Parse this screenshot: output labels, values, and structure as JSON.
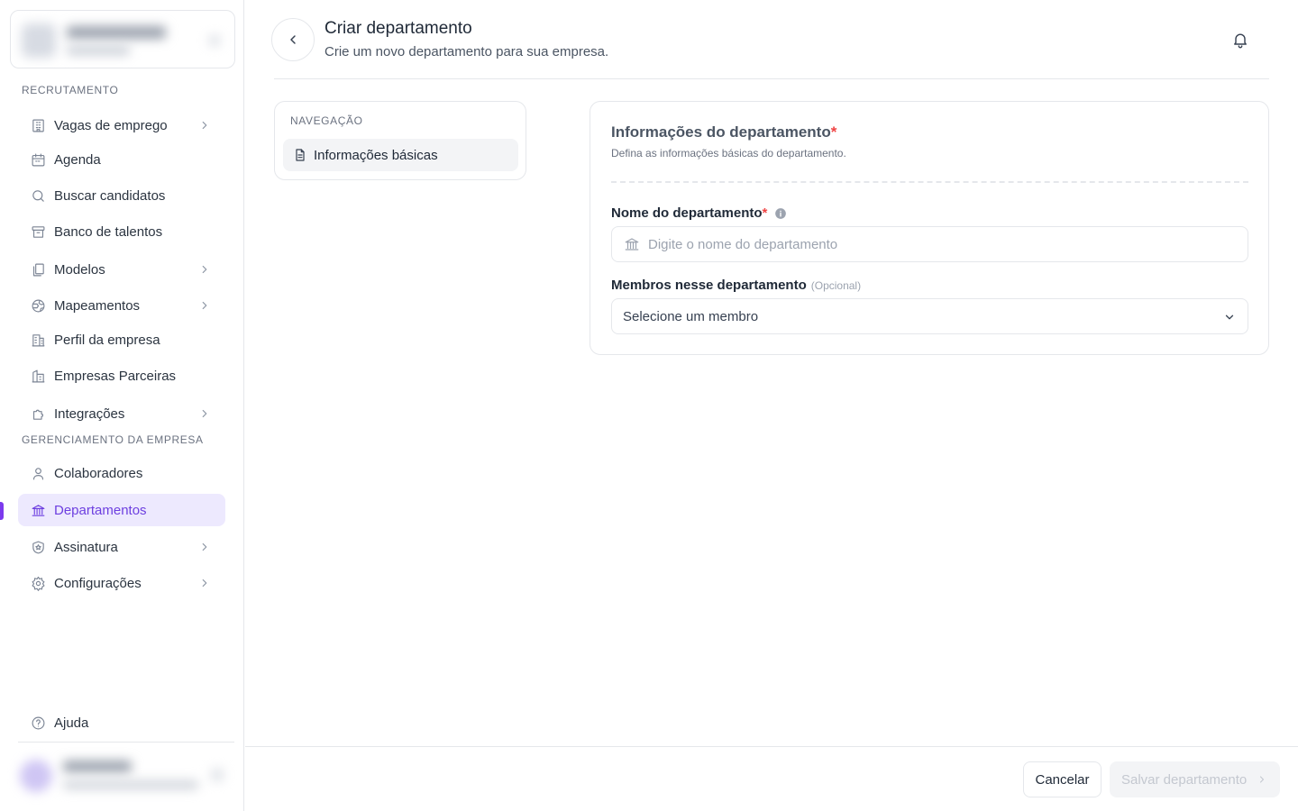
{
  "sidebar": {
    "sections": [
      {
        "label": "RECRUTAMENTO"
      },
      {
        "label": "GERENCIAMENTO DA EMPRESA"
      }
    ],
    "items": [
      {
        "label": "Vagas de emprego",
        "icon": "building-icon"
      },
      {
        "label": "Agenda",
        "icon": "calendar-icon"
      },
      {
        "label": "Buscar candidatos",
        "icon": "search-icon"
      },
      {
        "label": "Banco de talentos",
        "icon": "archive-icon"
      },
      {
        "label": "Modelos",
        "icon": "copy-icon"
      },
      {
        "label": "Mapeamentos",
        "icon": "globe-icon"
      },
      {
        "label": "Perfil da empresa",
        "icon": "company-icon"
      },
      {
        "label": "Empresas Parceiras",
        "icon": "partners-icon"
      },
      {
        "label": "Integrações",
        "icon": "puzzle-icon"
      },
      {
        "label": "Colaboradores",
        "icon": "user-icon"
      },
      {
        "label": "Departamentos",
        "icon": "bank-icon",
        "active": true
      },
      {
        "label": "Assinatura",
        "icon": "shield-icon"
      },
      {
        "label": "Configurações",
        "icon": "gear-icon"
      }
    ],
    "help_label": "Ajuda"
  },
  "header": {
    "title": "Criar departamento",
    "subtitle": "Crie um novo departamento para sua empresa."
  },
  "nav_card": {
    "label": "NAVEGAÇÃO",
    "item": "Informações básicas"
  },
  "form": {
    "title": "Informações do departamento",
    "required_mark": "*",
    "description": "Defina as informações básicas do departamento.",
    "name_label": "Nome do departamento",
    "name_placeholder": "Digite o nome do departamento",
    "members_label": "Membros nesse departamento",
    "members_optional": "(Opcional)",
    "members_value": "Selecione um membro"
  },
  "footer": {
    "cancel_label": "Cancelar",
    "save_label": "Salvar departamento"
  },
  "colors": {
    "accent": "#7c3aed",
    "active_bg": "#ede9fe",
    "required": "#ef4444"
  }
}
